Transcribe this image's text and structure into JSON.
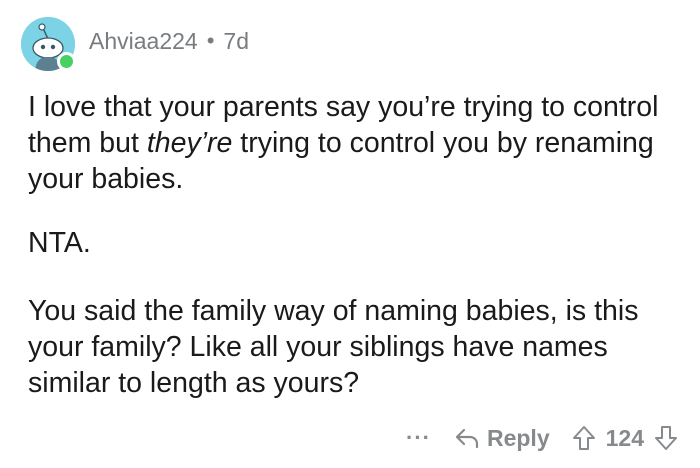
{
  "comment": {
    "author": "Ahviaa224",
    "separator": "•",
    "age": "7d",
    "paragraphs": {
      "p1_before": "I love that your parents say you’re trying to control them but ",
      "p1_emphasis": "they’re",
      "p1_after": " trying to control you by renaming your babies.",
      "p2": "NTA.",
      "p3": "You said the family way of naming babies, is this your family? Like all your siblings have names similar to length as yours?"
    }
  },
  "actions": {
    "more_label": "···",
    "reply_label": "Reply",
    "score": "124"
  },
  "colors": {
    "avatar_bg": "#7dd3e6",
    "online": "#46d160",
    "meta_text": "#787c7e",
    "body_text": "#1a1a1b"
  }
}
